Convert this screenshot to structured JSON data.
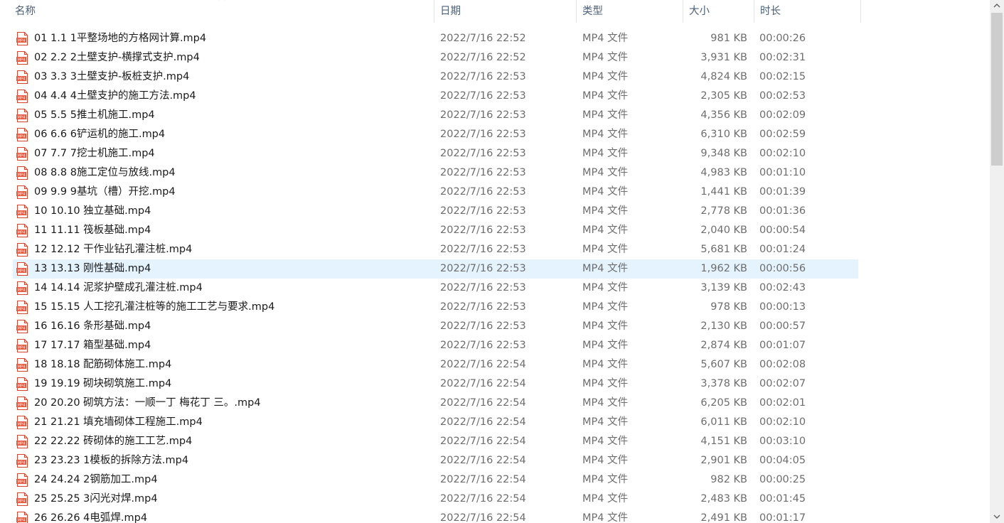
{
  "columns": {
    "name": "名称",
    "date": "日期",
    "type": "类型",
    "size": "大小",
    "duration": "时长"
  },
  "sort_indicator": "^",
  "icon_label": "MP4",
  "scrollbar": {
    "up": "▲",
    "down": "▼"
  },
  "hover_row_index": 12,
  "colors": {
    "header_text": "#4c607a",
    "hover_bg": "#e5f3ff",
    "icon_red": "#d9432b"
  },
  "files": [
    {
      "name": "01 1.1 1平整场地的方格网计算.mp4",
      "date": "2022/7/16 22:52",
      "type": "MP4 文件",
      "size": "981 KB",
      "duration": "00:00:26"
    },
    {
      "name": "02 2.2 2土壁支护-横撑式支护.mp4",
      "date": "2022/7/16 22:52",
      "type": "MP4 文件",
      "size": "3,931 KB",
      "duration": "00:02:31"
    },
    {
      "name": "03 3.3 3土壁支护-板桩支护.mp4",
      "date": "2022/7/16 22:53",
      "type": "MP4 文件",
      "size": "4,824 KB",
      "duration": "00:02:15"
    },
    {
      "name": "04 4.4 4土壁支护的施工方法.mp4",
      "date": "2022/7/16 22:53",
      "type": "MP4 文件",
      "size": "2,305 KB",
      "duration": "00:02:53"
    },
    {
      "name": "05 5.5 5推土机施工.mp4",
      "date": "2022/7/16 22:53",
      "type": "MP4 文件",
      "size": "4,356 KB",
      "duration": "00:02:09"
    },
    {
      "name": "06 6.6 6铲运机的施工.mp4",
      "date": "2022/7/16 22:53",
      "type": "MP4 文件",
      "size": "6,310 KB",
      "duration": "00:02:59"
    },
    {
      "name": "07 7.7 7挖士机施工.mp4",
      "date": "2022/7/16 22:53",
      "type": "MP4 文件",
      "size": "9,348 KB",
      "duration": "00:02:10"
    },
    {
      "name": "08 8.8 8施工定位与放线.mp4",
      "date": "2022/7/16 22:53",
      "type": "MP4 文件",
      "size": "4,983 KB",
      "duration": "00:01:10"
    },
    {
      "name": "09 9.9 9基坑（槽）开挖.mp4",
      "date": "2022/7/16 22:53",
      "type": "MP4 文件",
      "size": "1,441 KB",
      "duration": "00:01:39"
    },
    {
      "name": "10 10.10 独立基础.mp4",
      "date": "2022/7/16 22:53",
      "type": "MP4 文件",
      "size": "2,778 KB",
      "duration": "00:01:36"
    },
    {
      "name": "11 11.11 筏板基础.mp4",
      "date": "2022/7/16 22:53",
      "type": "MP4 文件",
      "size": "2,040 KB",
      "duration": "00:00:54"
    },
    {
      "name": "12 12.12 干作业钻孔灌注桩.mp4",
      "date": "2022/7/16 22:53",
      "type": "MP4 文件",
      "size": "5,681 KB",
      "duration": "00:01:24"
    },
    {
      "name": "13 13.13 刚性基础.mp4",
      "date": "2022/7/16 22:53",
      "type": "MP4 文件",
      "size": "1,962 KB",
      "duration": "00:00:56"
    },
    {
      "name": "14 14.14 泥浆护壁成孔灌注桩.mp4",
      "date": "2022/7/16 22:53",
      "type": "MP4 文件",
      "size": "3,139 KB",
      "duration": "00:02:43"
    },
    {
      "name": "15 15.15 人工挖孔灌注桩等的施工工艺与要求.mp4",
      "date": "2022/7/16 22:53",
      "type": "MP4 文件",
      "size": "978 KB",
      "duration": "00:00:13"
    },
    {
      "name": "16 16.16 条形基础.mp4",
      "date": "2022/7/16 22:53",
      "type": "MP4 文件",
      "size": "2,130 KB",
      "duration": "00:00:57"
    },
    {
      "name": "17 17.17 箱型基础.mp4",
      "date": "2022/7/16 22:53",
      "type": "MP4 文件",
      "size": "2,874 KB",
      "duration": "00:01:07"
    },
    {
      "name": "18 18.18 配筋砌体施工.mp4",
      "date": "2022/7/16 22:54",
      "type": "MP4 文件",
      "size": "5,607 KB",
      "duration": "00:02:08"
    },
    {
      "name": "19 19.19 砌块砌筑施工.mp4",
      "date": "2022/7/16 22:54",
      "type": "MP4 文件",
      "size": "3,378 KB",
      "duration": "00:02:07"
    },
    {
      "name": "20 20.20 砌筑方法：一顺一丁 梅花丁 三。.mp4",
      "date": "2022/7/16 22:54",
      "type": "MP4 文件",
      "size": "6,205 KB",
      "duration": "00:02:01"
    },
    {
      "name": "21 21.21 填充墙砌体工程施工.mp4",
      "date": "2022/7/16 22:54",
      "type": "MP4 文件",
      "size": "6,011 KB",
      "duration": "00:02:10"
    },
    {
      "name": "22 22.22 砖砌体的施工工艺.mp4",
      "date": "2022/7/16 22:54",
      "type": "MP4 文件",
      "size": "4,151 KB",
      "duration": "00:03:10"
    },
    {
      "name": "23 23.23 1模板的拆除方法.mp4",
      "date": "2022/7/16 22:54",
      "type": "MP4 文件",
      "size": "2,901 KB",
      "duration": "00:04:05"
    },
    {
      "name": "24 24.24 2钢筋加工.mp4",
      "date": "2022/7/16 22:54",
      "type": "MP4 文件",
      "size": "982 KB",
      "duration": "00:00:25"
    },
    {
      "name": "25 25.25 3闪光对焊.mp4",
      "date": "2022/7/16 22:54",
      "type": "MP4 文件",
      "size": "2,483 KB",
      "duration": "00:01:45"
    },
    {
      "name": "26 26.26 4电弧焊.mp4",
      "date": "2022/7/16 22:54",
      "type": "MP4 文件",
      "size": "2,491 KB",
      "duration": "00:01:17"
    }
  ]
}
